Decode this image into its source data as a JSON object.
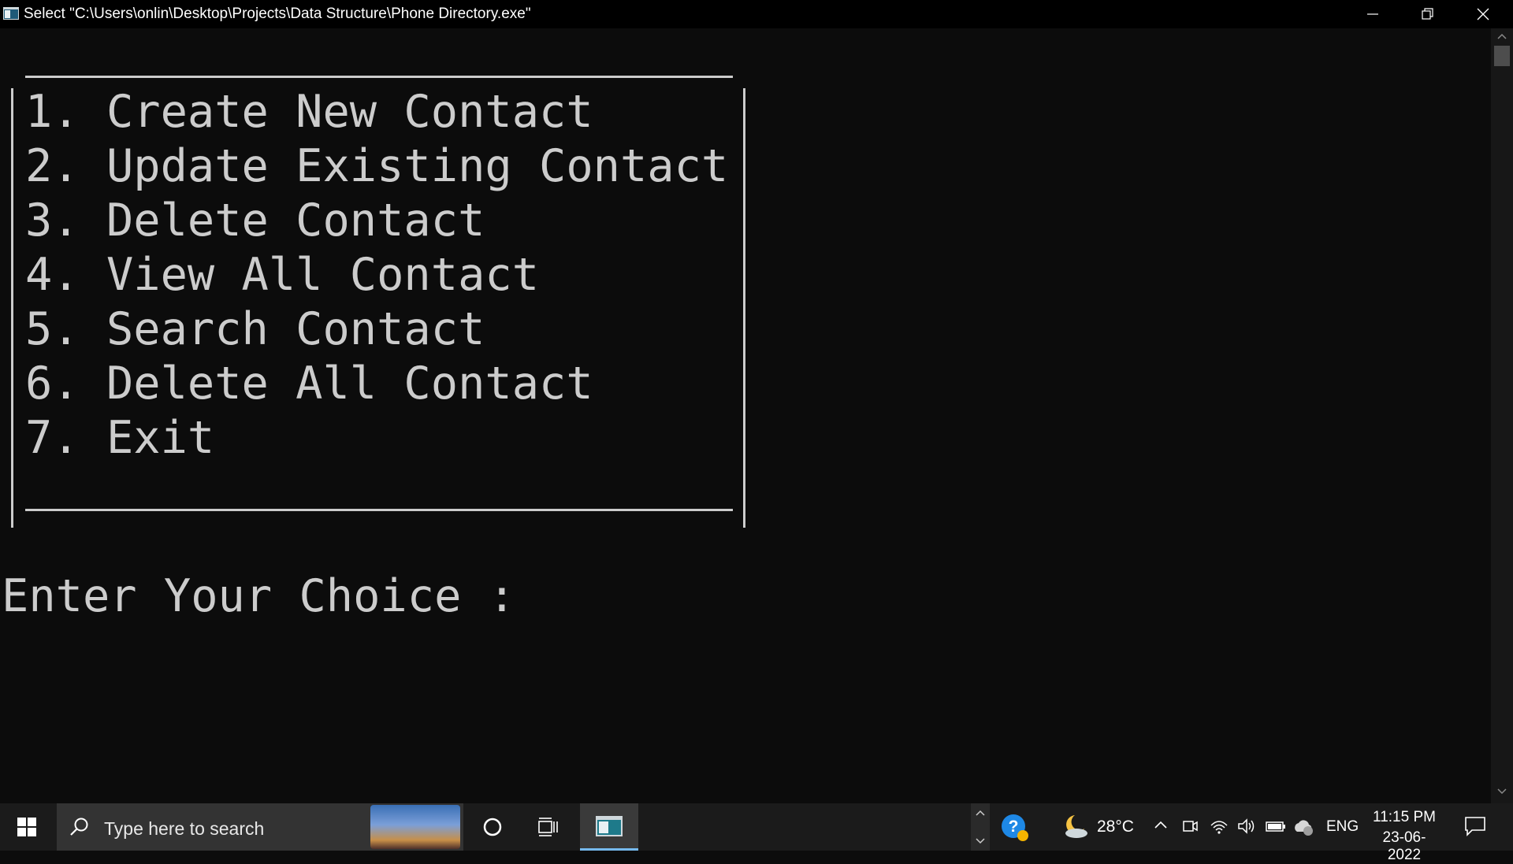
{
  "window": {
    "title": "Select \"C:\\Users\\onlin\\Desktop\\Projects\\Data Structure\\Phone Directory.exe\"",
    "icon": "console-app-icon",
    "controls": [
      "minimize-icon",
      "restore-icon",
      "close-icon"
    ]
  },
  "console": {
    "menu_items": [
      "1. Create New Contact",
      "2. Update Existing Contact",
      "3. Delete Contact",
      "4. View All Contact",
      "5. Search Contact",
      "6. Delete All Contact",
      "7. Exit"
    ],
    "prompt": "Enter Your Choice :",
    "text_color": "#cccccc",
    "background": "#0c0c0c"
  },
  "taskbar": {
    "search_placeholder": "Type here to search",
    "icons": [
      "windows-start-icon",
      "search-icon",
      "cortana-icon",
      "task-view-icon",
      "console-app-icon",
      "help-icon",
      "weather-icon",
      "chevron-up-icon",
      "meet-now-icon",
      "wifi-icon",
      "volume-icon",
      "battery-icon",
      "onedrive-icon",
      "notification-icon"
    ],
    "weather_temp": "28°C",
    "language": "ENG",
    "time": "11:15 PM",
    "date": "23-06-2022",
    "accent": "#76b9ed"
  }
}
